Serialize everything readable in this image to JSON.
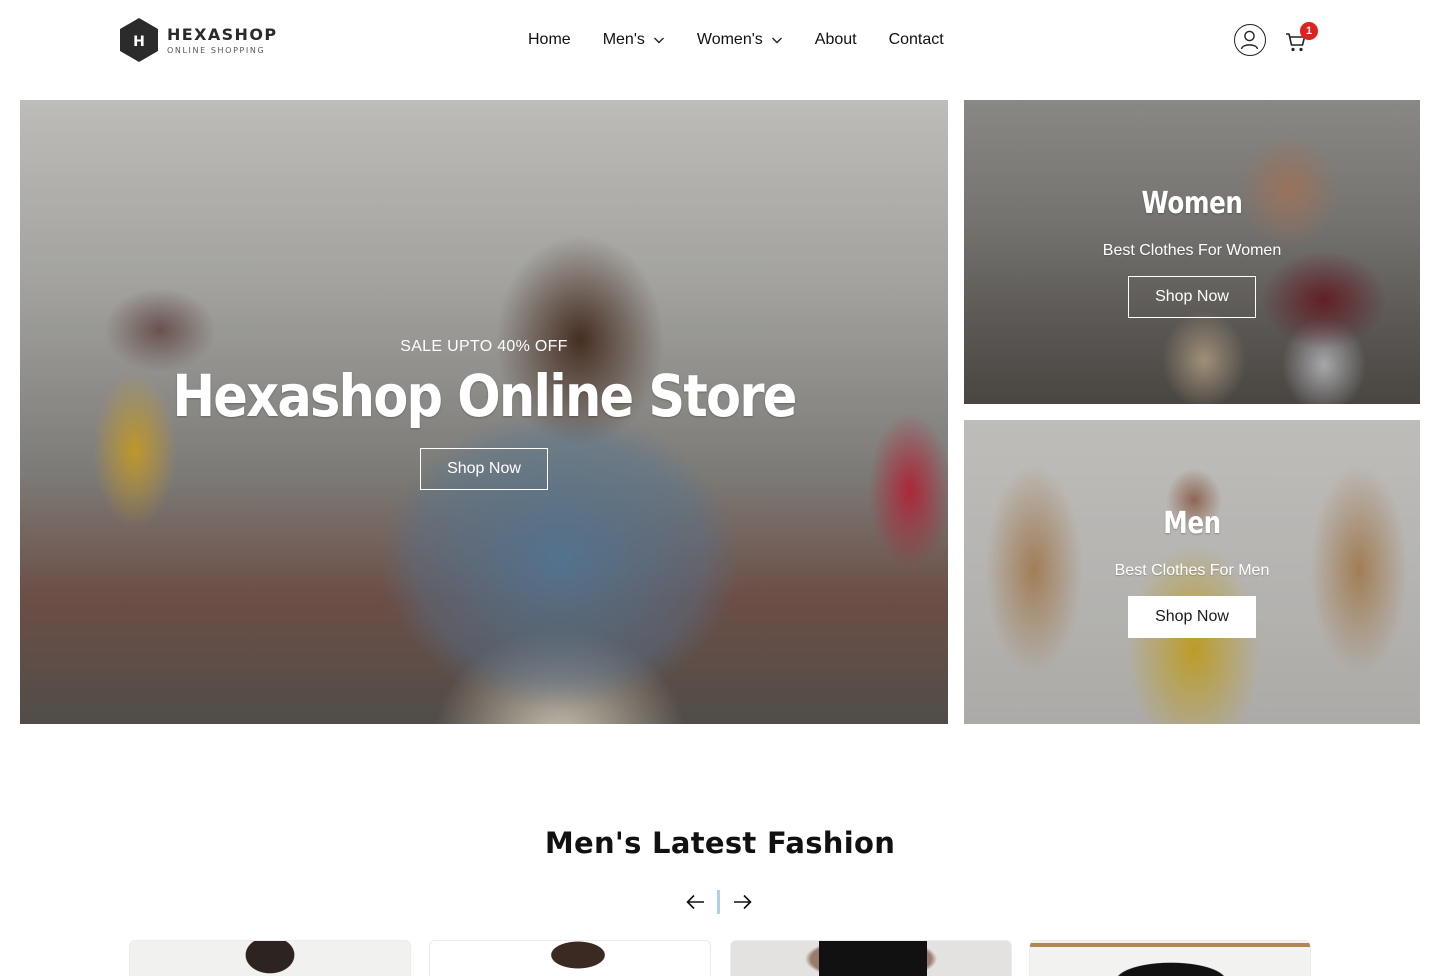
{
  "brand": {
    "logo_letter": "H",
    "name": "HEXASHOP",
    "tagline": "ONLINE SHOPPING"
  },
  "nav": {
    "items": [
      {
        "label": "Home",
        "has_dropdown": false
      },
      {
        "label": "Men's",
        "has_dropdown": true
      },
      {
        "label": "Women's",
        "has_dropdown": true
      },
      {
        "label": "About",
        "has_dropdown": false
      },
      {
        "label": "Contact",
        "has_dropdown": false
      }
    ]
  },
  "header_icons": {
    "user_icon": "user-icon",
    "cart_icon": "cart-icon",
    "cart_count": "1",
    "badge_color": "#e0211d"
  },
  "hero": {
    "subtitle": "SALE UPTO 40% OFF",
    "title": "Hexashop Online Store",
    "button_label": "Shop Now"
  },
  "side_cards": {
    "women": {
      "title": "Women",
      "subtitle": "Best Clothes For Women",
      "button_label": "Shop Now"
    },
    "men": {
      "title": "Men",
      "subtitle": "Best Clothes For Men",
      "button_label": "Shop Now"
    }
  },
  "latest_section": {
    "title": "Men's Latest Fashion",
    "prev_icon": "arrow-left-icon",
    "next_icon": "arrow-right-icon",
    "accent": "#a9d2ef"
  }
}
